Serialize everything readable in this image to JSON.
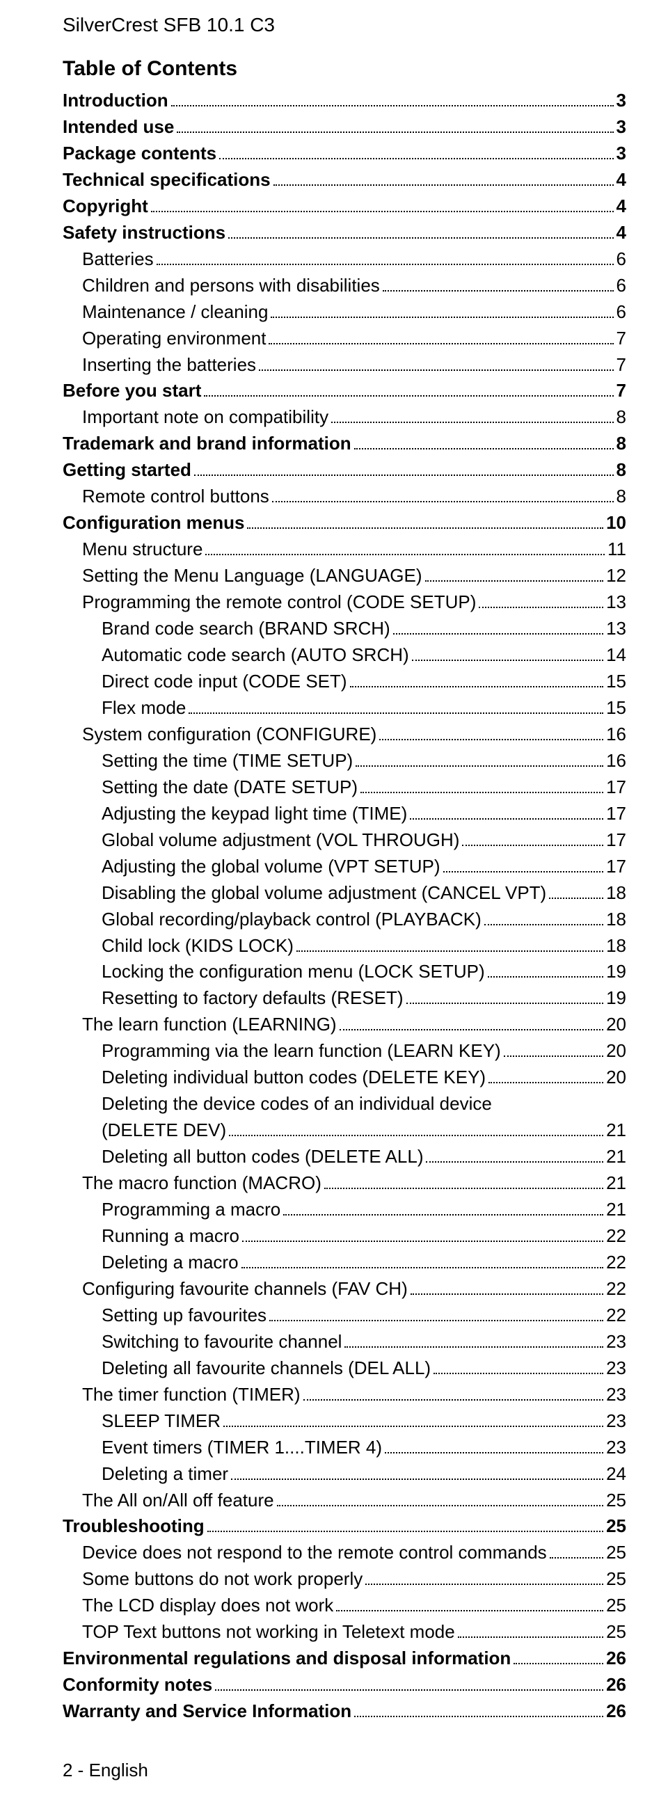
{
  "header": "SilverCrest SFB 10.1 C3",
  "toc_title": "Table of Contents",
  "footer": "2 - English",
  "toc": [
    {
      "label": "Introduction",
      "page": "3",
      "bold": true,
      "indent": 0
    },
    {
      "label": "Intended use",
      "page": "3",
      "bold": true,
      "indent": 0
    },
    {
      "label": "Package contents",
      "page": "3",
      "bold": true,
      "indent": 0
    },
    {
      "label": "Technical specifications",
      "page": "4",
      "bold": true,
      "indent": 0
    },
    {
      "label": "Copyright",
      "page": "4",
      "bold": true,
      "indent": 0
    },
    {
      "label": "Safety instructions",
      "page": "4",
      "bold": true,
      "indent": 0
    },
    {
      "label": "Batteries",
      "page": "6",
      "bold": false,
      "indent": 1
    },
    {
      "label": "Children and persons with disabilities",
      "page": "6",
      "bold": false,
      "indent": 1
    },
    {
      "label": "Maintenance / cleaning",
      "page": "6",
      "bold": false,
      "indent": 1
    },
    {
      "label": "Operating environment",
      "page": "7",
      "bold": false,
      "indent": 1
    },
    {
      "label": "Inserting the batteries",
      "page": "7",
      "bold": false,
      "indent": 1
    },
    {
      "label": "Before you start",
      "page": "7",
      "bold": true,
      "indent": 0
    },
    {
      "label": "Important note on compatibility",
      "page": "8",
      "bold": false,
      "indent": 1
    },
    {
      "label": "Trademark and brand information",
      "page": "8",
      "bold": true,
      "indent": 0
    },
    {
      "label": "Getting started",
      "page": "8",
      "bold": true,
      "indent": 0
    },
    {
      "label": "Remote control buttons",
      "page": "8",
      "bold": false,
      "indent": 1
    },
    {
      "label": "Configuration menus",
      "page": "10",
      "bold": true,
      "indent": 0
    },
    {
      "label": "Menu structure",
      "page": "11",
      "bold": false,
      "indent": 1
    },
    {
      "label": "Setting the Menu Language (LANGUAGE)",
      "page": "12",
      "bold": false,
      "indent": 1
    },
    {
      "label": "Programming the remote control (CODE SETUP)",
      "page": "13",
      "bold": false,
      "indent": 1
    },
    {
      "label": "Brand code search (BRAND SRCH)",
      "page": "13",
      "bold": false,
      "indent": 2
    },
    {
      "label": "Automatic code search (AUTO SRCH)",
      "page": "14",
      "bold": false,
      "indent": 2
    },
    {
      "label": "Direct code input (CODE SET)",
      "page": "15",
      "bold": false,
      "indent": 2
    },
    {
      "label": "Flex mode",
      "page": "15",
      "bold": false,
      "indent": 2
    },
    {
      "label": "System configuration (CONFIGURE)",
      "page": "16",
      "bold": false,
      "indent": 1
    },
    {
      "label": "Setting the time (TIME SETUP)",
      "page": "16",
      "bold": false,
      "indent": 2
    },
    {
      "label": "Setting the date (DATE SETUP)",
      "page": "17",
      "bold": false,
      "indent": 2
    },
    {
      "label": "Adjusting the keypad light time (TIME)",
      "page": "17",
      "bold": false,
      "indent": 2
    },
    {
      "label": "Global volume adjustment (VOL THROUGH)",
      "page": "17",
      "bold": false,
      "indent": 2
    },
    {
      "label": "Adjusting the global volume (VPT SETUP)",
      "page": "17",
      "bold": false,
      "indent": 2
    },
    {
      "label": "Disabling the global volume adjustment (CANCEL VPT)",
      "page": "18",
      "bold": false,
      "indent": 2
    },
    {
      "label": "Global recording/playback control (PLAYBACK)",
      "page": "18",
      "bold": false,
      "indent": 2
    },
    {
      "label": "Child lock (KIDS LOCK)",
      "page": "18",
      "bold": false,
      "indent": 2
    },
    {
      "label": "Locking the configuration menu (LOCK SETUP)",
      "page": "19",
      "bold": false,
      "indent": 2
    },
    {
      "label": "Resetting to factory defaults (RESET)",
      "page": "19",
      "bold": false,
      "indent": 2
    },
    {
      "label": "The learn function (LEARNING)",
      "page": "20",
      "bold": false,
      "indent": 1
    },
    {
      "label": "Programming via the learn function (LEARN KEY)",
      "page": "20",
      "bold": false,
      "indent": 2
    },
    {
      "label": "Deleting individual button codes (DELETE KEY)",
      "page": "20",
      "bold": false,
      "indent": 2
    },
    {
      "label": "Deleting the device codes of an individual device (DELETE DEV)",
      "page": "21",
      "bold": false,
      "indent": 2,
      "wrap": true,
      "wrap_at": "(DELETE DEV)"
    },
    {
      "label": "Deleting all button codes (DELETE ALL)",
      "page": "21",
      "bold": false,
      "indent": 2
    },
    {
      "label": "The macro function (MACRO)",
      "page": "21",
      "bold": false,
      "indent": 1
    },
    {
      "label": "Programming a macro",
      "page": "21",
      "bold": false,
      "indent": 2
    },
    {
      "label": "Running a macro",
      "page": "22",
      "bold": false,
      "indent": 2
    },
    {
      "label": "Deleting a macro",
      "page": "22",
      "bold": false,
      "indent": 2
    },
    {
      "label": "Configuring favourite channels (FAV CH)",
      "page": "22",
      "bold": false,
      "indent": 1
    },
    {
      "label": "Setting up favourites",
      "page": "22",
      "bold": false,
      "indent": 2
    },
    {
      "label": "Switching to favourite channel",
      "page": "23",
      "bold": false,
      "indent": 2
    },
    {
      "label": "Deleting all favourite channels (DEL ALL)",
      "page": "23",
      "bold": false,
      "indent": 2
    },
    {
      "label": "The timer function (TIMER)",
      "page": "23",
      "bold": false,
      "indent": 1
    },
    {
      "label": "SLEEP TIMER",
      "page": "23",
      "bold": false,
      "indent": 2
    },
    {
      "label": "Event timers (TIMER 1....TIMER 4)",
      "page": "23",
      "bold": false,
      "indent": 2
    },
    {
      "label": "Deleting a timer",
      "page": "24",
      "bold": false,
      "indent": 2
    },
    {
      "label": "The All on/All off feature",
      "page": "25",
      "bold": false,
      "indent": 1
    },
    {
      "label": "Troubleshooting",
      "page": "25",
      "bold": true,
      "indent": 0
    },
    {
      "label": "Device does not respond to the remote control commands",
      "page": "25",
      "bold": false,
      "indent": 1
    },
    {
      "label": "Some buttons do not work properly",
      "page": "25",
      "bold": false,
      "indent": 1
    },
    {
      "label": "The LCD display does not work",
      "page": "25",
      "bold": false,
      "indent": 1
    },
    {
      "label": "TOP Text buttons not working in Teletext mode",
      "page": "25",
      "bold": false,
      "indent": 1
    },
    {
      "label": "Environmental regulations and disposal information",
      "page": "26",
      "bold": true,
      "indent": 0
    },
    {
      "label": "Conformity notes",
      "page": "26",
      "bold": true,
      "indent": 0
    },
    {
      "label": "Warranty and Service Information",
      "page": "26",
      "bold": true,
      "indent": 0
    }
  ]
}
